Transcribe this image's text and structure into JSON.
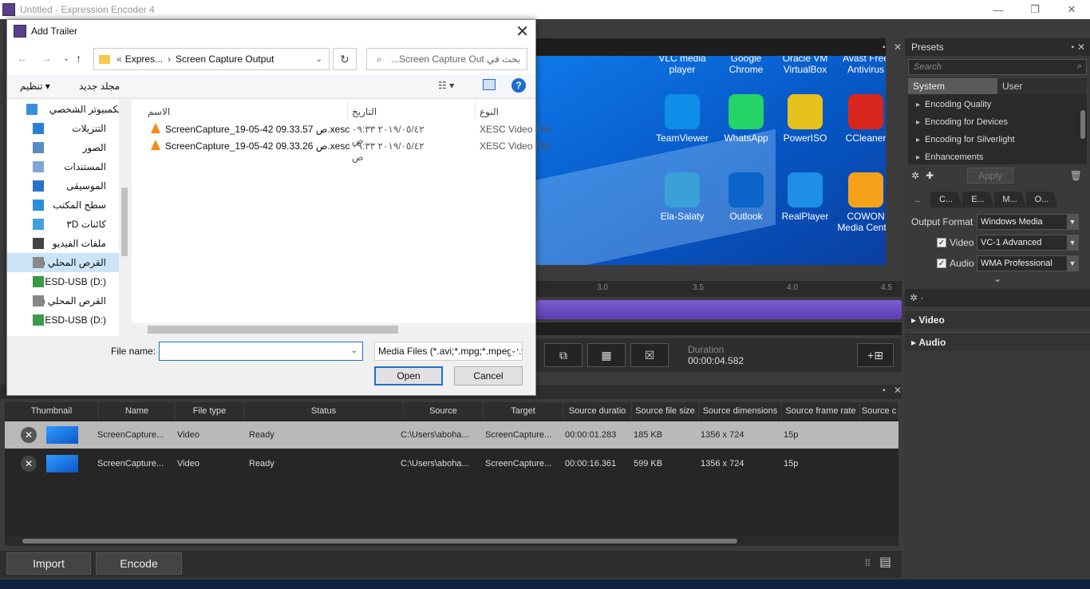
{
  "app": {
    "title": "Untitled - Expression Encoder 4",
    "window_controls": [
      "—",
      "❐",
      "✕"
    ]
  },
  "preview": {
    "desktop_icons": [
      {
        "label": "VLC media player",
        "color": "#f28a16"
      },
      {
        "label": "Google Chrome",
        "color": "#dd4b39"
      },
      {
        "label": "Oracle VM VirtualBox",
        "color": "#1b5fa8"
      },
      {
        "label": "Avast Free Antivirus",
        "color": "#f07a1a"
      },
      {
        "label": "TeamViewer",
        "color": "#0e8ee9"
      },
      {
        "label": "WhatsApp",
        "color": "#25d366"
      },
      {
        "label": "PowerISO",
        "color": "#e6c21c"
      },
      {
        "label": "CCleaner",
        "color": "#d9261c"
      },
      {
        "label": "Ela-Salaty",
        "color": "#3aa0d8"
      },
      {
        "label": "Outlook",
        "color": "#0a64c9"
      },
      {
        "label": "RealPlayer",
        "color": "#1d8fe6"
      },
      {
        "label": "COWON Media Cent...",
        "color": "#f5a21a"
      }
    ]
  },
  "timeline": {
    "ticks": [
      "3.0",
      "3.5",
      "4.0",
      "4.5"
    ],
    "duration_label": "Duration",
    "duration_value": "00:00:04.582"
  },
  "presets_panel": {
    "header": "Presets",
    "search_placeholder": "Search",
    "tabs": [
      "System",
      "User"
    ],
    "items": [
      "Encoding Quality",
      "Encoding for Devices",
      "Encoding for Silverlight",
      "Enhancements"
    ],
    "apply_label": "Apply"
  },
  "encode_panel": {
    "tabs": [
      "..",
      "C...",
      "E...",
      "M...",
      "O..."
    ],
    "output_format_label": "Output Format",
    "output_format_value": "Windows Media",
    "video_label": "Video",
    "video_value": "VC-1 Advanced",
    "audio_label": "Audio",
    "audio_value": "WMA Professional",
    "sections": [
      "Video",
      "Audio"
    ]
  },
  "media_list": {
    "columns": [
      "Thumbnail",
      "Name",
      "File type",
      "Status",
      "Source",
      "Target",
      "Source duratio",
      "Source file size",
      "Source dimensions",
      "Source frame rate",
      "Source c"
    ],
    "rows": [
      {
        "name": "ScreenCapture...",
        "type": "Video",
        "status": "Ready",
        "source": "C:\\Users\\aboha...",
        "target": "ScreenCapture...",
        "duration": "00:00:01.283",
        "size": "185 KB",
        "dimensions": "1356 x 724",
        "fps": "15p"
      },
      {
        "name": "ScreenCapture...",
        "type": "Video",
        "status": "Ready",
        "source": "C:\\Users\\aboha...",
        "target": "ScreenCapture...",
        "duration": "00:00:16.361",
        "size": "599 KB",
        "dimensions": "1356 x 724",
        "fps": "15p"
      }
    ]
  },
  "bottom_bar": {
    "import_label": "Import",
    "encode_label": "Encode"
  },
  "dialog": {
    "title": "Add Trailer",
    "breadcrumb": [
      "Expres...",
      "Screen Capture Output"
    ],
    "search_placeholder": "بحث في Screen Capture Out...",
    "organize_label": "تنظيم ▾",
    "new_folder_label": "مجلد جديد",
    "nav_items": [
      {
        "label": "الكمبيوتر الشخصي",
        "icon": "computer-icon",
        "color": "#3a8ee0"
      },
      {
        "label": "التنزيلات",
        "icon": "download-icon",
        "color": "#2a7fd4"
      },
      {
        "label": "الصور",
        "icon": "pictures-icon",
        "color": "#5a8bc0"
      },
      {
        "label": "المستندات",
        "icon": "documents-icon",
        "color": "#7fa7d0"
      },
      {
        "label": "الموسيقى",
        "icon": "music-icon",
        "color": "#2a72c8"
      },
      {
        "label": "سطح المكتب",
        "icon": "desktop-icon",
        "color": "#2a8fd8"
      },
      {
        "label": "كائنات ٣D",
        "icon": "3d-objects-icon",
        "color": "#3fa0e0"
      },
      {
        "label": "ملفات الفيديو",
        "icon": "videos-icon",
        "color": "#444"
      },
      {
        "label": "القرص المحلي (C:",
        "icon": "drive-icon",
        "color": "#888"
      },
      {
        "label": "ESD-USB (D:)",
        "icon": "usb-drive-icon",
        "color": "#3a9a4a"
      },
      {
        "label": "القرص المحلي (E:",
        "icon": "drive-icon",
        "color": "#888"
      },
      {
        "label": "ESD-USB (D:)",
        "icon": "usb-drive-icon",
        "color": "#3a9a4a"
      }
    ],
    "columns": {
      "name": "الاسم",
      "date": "التاريخ",
      "type": "النوع"
    },
    "files": [
      {
        "name": "ScreenCapture_19-05-42 09.33.57 ص.xesc",
        "date": "٢٠١٩/٠٥/٤٢ ٠٩:٣٣ ص",
        "type": "XESC Video File"
      },
      {
        "name": "ScreenCapture_19-05-42 09.33.26 ص.xesc",
        "date": "٢٠١٩/٠٥/٤٢ ٠٩:٣٣ ص",
        "type": "XESC Video File"
      }
    ],
    "file_name_label": "File name:",
    "file_name_value": "",
    "file_type_value": "Media Files (*.avi;*.mpg;*.mpeg;*.wmv)",
    "open_label": "Open",
    "cancel_label": "Cancel"
  }
}
